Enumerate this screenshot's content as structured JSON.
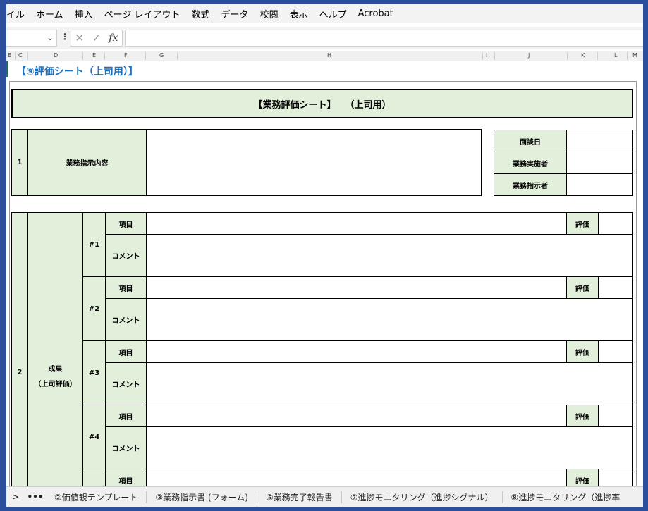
{
  "menu": [
    "イル",
    "ホーム",
    "挿入",
    "ページ レイアウト",
    "数式",
    "データ",
    "校閲",
    "表示",
    "ヘルプ",
    "Acrobat"
  ],
  "formula_bar": {
    "cancel_glyph": "✕",
    "enter_glyph": "✓",
    "fx_label": "fx",
    "dots": "⋮",
    "chevron": "⌄",
    "value": ""
  },
  "columns": [
    "B",
    "C",
    "D",
    "E",
    "F",
    "G",
    "H",
    "I",
    "J",
    "K",
    "L",
    "M"
  ],
  "sheet_title": "【⑨評価シート（上司用）】",
  "banner": "【業務評価シート】　　（上司用）",
  "row1": {
    "number": "1",
    "label": "業務指示内容"
  },
  "meta": {
    "interview_date": "面談日",
    "performer": "業務実施者",
    "instructor": "業務指示者"
  },
  "row2": {
    "number": "2",
    "label_line1": "成果",
    "label_line2": "（上司評価）"
  },
  "items": [
    {
      "no": "#1",
      "item_label": "項目",
      "comment_label": "コメント",
      "eval_label": "評価"
    },
    {
      "no": "#2",
      "item_label": "項目",
      "comment_label": "コメント",
      "eval_label": "評価"
    },
    {
      "no": "#3",
      "item_label": "項目",
      "comment_label": "コメント",
      "eval_label": "評価"
    },
    {
      "no": "#4",
      "item_label": "項目",
      "comment_label": "コメント",
      "eval_label": "評価"
    },
    {
      "no": "",
      "item_label": "項目",
      "comment_label": "",
      "eval_label": "評価"
    }
  ],
  "tabs": {
    "nav": ">",
    "more": "•••",
    "items": [
      "②価値観テンプレート",
      "③業務指示書 (フォーム)",
      "⑤業務完了報告書",
      "⑦進捗モニタリング（進捗シグナル）",
      "⑧進捗モニタリング（進捗率"
    ]
  },
  "colors": {
    "header_green": "#e2efda",
    "title_blue": "#1f6fbf",
    "frame_blue": "#2b4f9c"
  }
}
